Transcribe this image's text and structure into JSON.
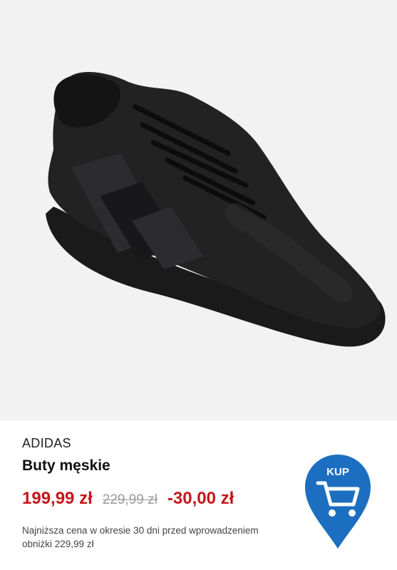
{
  "product": {
    "brand": "ADIDAS",
    "title": "Buty męskie",
    "image": "black-running-shoe"
  },
  "pricing": {
    "current": "199,99 zł",
    "old": "229,99 zł",
    "discount": "-30,00 zł",
    "lowest_note": "Najniższa cena w okresie 30 dni przed wprowadzeniem obniżki 229,99 zł"
  },
  "cta": {
    "label": "KUP",
    "icon": "shopping-cart-icon"
  },
  "colors": {
    "accent_red": "#c4161c",
    "cta_blue": "#1c6fc0",
    "image_bg": "#f2f2f2"
  }
}
